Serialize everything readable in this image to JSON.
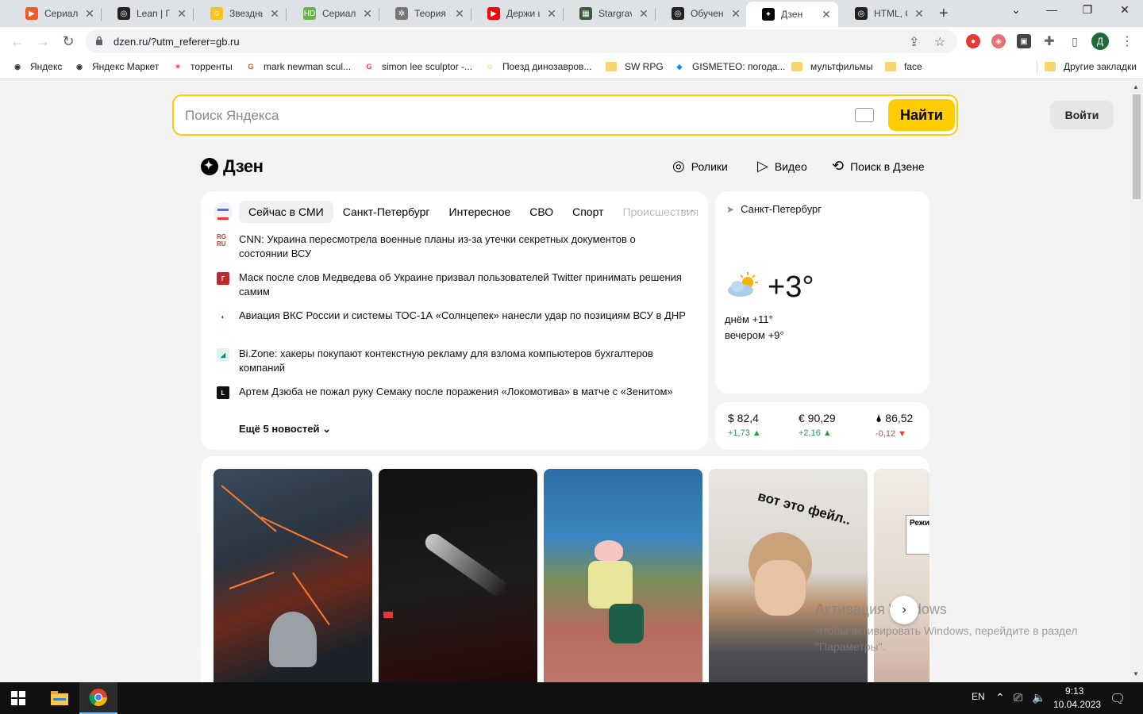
{
  "browser": {
    "tabs": [
      {
        "title": "Сериал З...",
        "fav_color": "#f15a24",
        "fav_glyph": "▶"
      },
      {
        "title": "Lean | Гиб...",
        "fav_color": "#222222",
        "fav_glyph": "◎"
      },
      {
        "title": "Звездные...",
        "fav_color": "#f5c518",
        "fav_glyph": "☺"
      },
      {
        "title": "Сериал З...",
        "fav_color": "#6ab04c",
        "fav_glyph": "HD"
      },
      {
        "title": "Теория б...",
        "fav_color": "#777777",
        "fav_glyph": "✲"
      },
      {
        "title": "Держи ш...",
        "fav_color": "#ff0000",
        "fav_glyph": "▶"
      },
      {
        "title": "Stargrave",
        "fav_color": "#3d5a3d",
        "fav_glyph": "▦"
      },
      {
        "title": "Обучени...",
        "fav_color": "#222222",
        "fav_glyph": "◎"
      },
      {
        "title": "Дзен",
        "fav_color": "#000000",
        "fav_glyph": "✦",
        "active": true
      },
      {
        "title": "HTML, CS...",
        "fav_color": "#222222",
        "fav_glyph": "◎"
      }
    ],
    "new_tab_label": "+",
    "url": "dzen.ru/?utm_referer=gb.ru",
    "profile_initial": "Д",
    "bookmarks": [
      {
        "label": "Яндекс",
        "kind": "site",
        "icon_color": "#333333",
        "icon_glyph": "◉"
      },
      {
        "label": "Яндекс Маркет",
        "kind": "site",
        "icon_color": "#333333",
        "icon_glyph": "◉"
      },
      {
        "label": "торренты",
        "kind": "site",
        "icon_color": "#e83e8c",
        "icon_glyph": "✶"
      },
      {
        "label": "mark newman scul...",
        "kind": "site",
        "icon_color": "#ea4335",
        "icon_glyph": "G"
      },
      {
        "label": "simon lee sculptor -...",
        "kind": "site",
        "icon_color": "#ea4335",
        "icon_glyph": "G"
      },
      {
        "label": "Поезд динозавров...",
        "kind": "site",
        "icon_color": "#f5c518",
        "icon_glyph": "☺"
      },
      {
        "label": "SW RPG",
        "kind": "folder"
      },
      {
        "label": "GISMETEO: погода...",
        "kind": "site",
        "icon_color": "#1e88e5",
        "icon_glyph": "◆"
      },
      {
        "label": "мультфильмы",
        "kind": "folder"
      },
      {
        "label": "face",
        "kind": "folder"
      }
    ],
    "other_bookmarks": "Другие закладки"
  },
  "page": {
    "search_placeholder": "Поиск Яндекса",
    "search_button": "Найти",
    "login_button": "Войти",
    "logo_text": "Дзен",
    "nav": [
      {
        "label": "Ролики",
        "icon": "clips-icon"
      },
      {
        "label": "Видео",
        "icon": "play-icon"
      },
      {
        "label": "Поиск в Дзене",
        "icon": "search-sparkle-icon"
      }
    ],
    "news": {
      "tabs": [
        "Сейчас в СМИ",
        "Санкт-Петербург",
        "Интересное",
        "СВО",
        "Спорт",
        "Происшествия"
      ],
      "active_tab": 0,
      "items": [
        {
          "source_mark": "RG RU",
          "mark_bg": "#ffffff",
          "mark_color": "#c0392b",
          "text": "CNN: Украина пересмотрела военные планы из-за утечки секретных документов о состоянии ВСУ"
        },
        {
          "source_mark": "Г",
          "mark_bg": "#c62828",
          "mark_color": "#ffffff",
          "text": "Маск после слов Медведева об Украине призвал пользователей Twitter принимать решения самим"
        },
        {
          "source_mark": "◐",
          "mark_bg": "#ffffff",
          "mark_color": "#1e3a8a",
          "text": "Авиация ВКС России и системы ТОС-1А «Солнцепек» нанесли удар по позициям ВСУ в ДНР"
        },
        {
          "source_mark": "◢",
          "mark_bg": "#e0f2f1",
          "mark_color": "#00897b",
          "text": "Bi.Zone: хакеры покупают контекстную рекламу для взлома компьютеров бухгалтеров компаний"
        },
        {
          "source_mark": "L",
          "mark_bg": "#111111",
          "mark_color": "#ffffff",
          "text": "Артем Дзюба не пожал руку Семаку после поражения «Локомотива» в матче с «Зенитом»"
        }
      ],
      "more_label": "Ещё 5 новостей"
    },
    "weather": {
      "city": "Санкт-Петербург",
      "temp": "+3°",
      "day": "днём +11°",
      "evening": "вечером +9°"
    },
    "rates": [
      {
        "value": "$ 82,4",
        "delta": "+1,73",
        "direction": "up"
      },
      {
        "value": "€ 90,29",
        "delta": "+2,16",
        "direction": "up"
      },
      {
        "value": "🌢 86,52",
        "delta": "-0,12",
        "direction": "down"
      }
    ],
    "videos": [
      {
        "caption": ""
      },
      {
        "caption": ""
      },
      {
        "caption": ""
      },
      {
        "caption": "вот это фейл.."
      },
      {
        "caption": "Режи спра филь"
      }
    ],
    "watermark": {
      "title": "Активация Windows",
      "text": "Чтобы активировать Windows, перейдите в раздел \"Параметры\"."
    }
  },
  "taskbar": {
    "lang": "EN",
    "time": "9:13",
    "date": "10.04.2023"
  },
  "colors": {
    "accent_yellow": "#ffcc00",
    "up_green": "#2a9d4a",
    "down_red": "#e63b3b"
  }
}
